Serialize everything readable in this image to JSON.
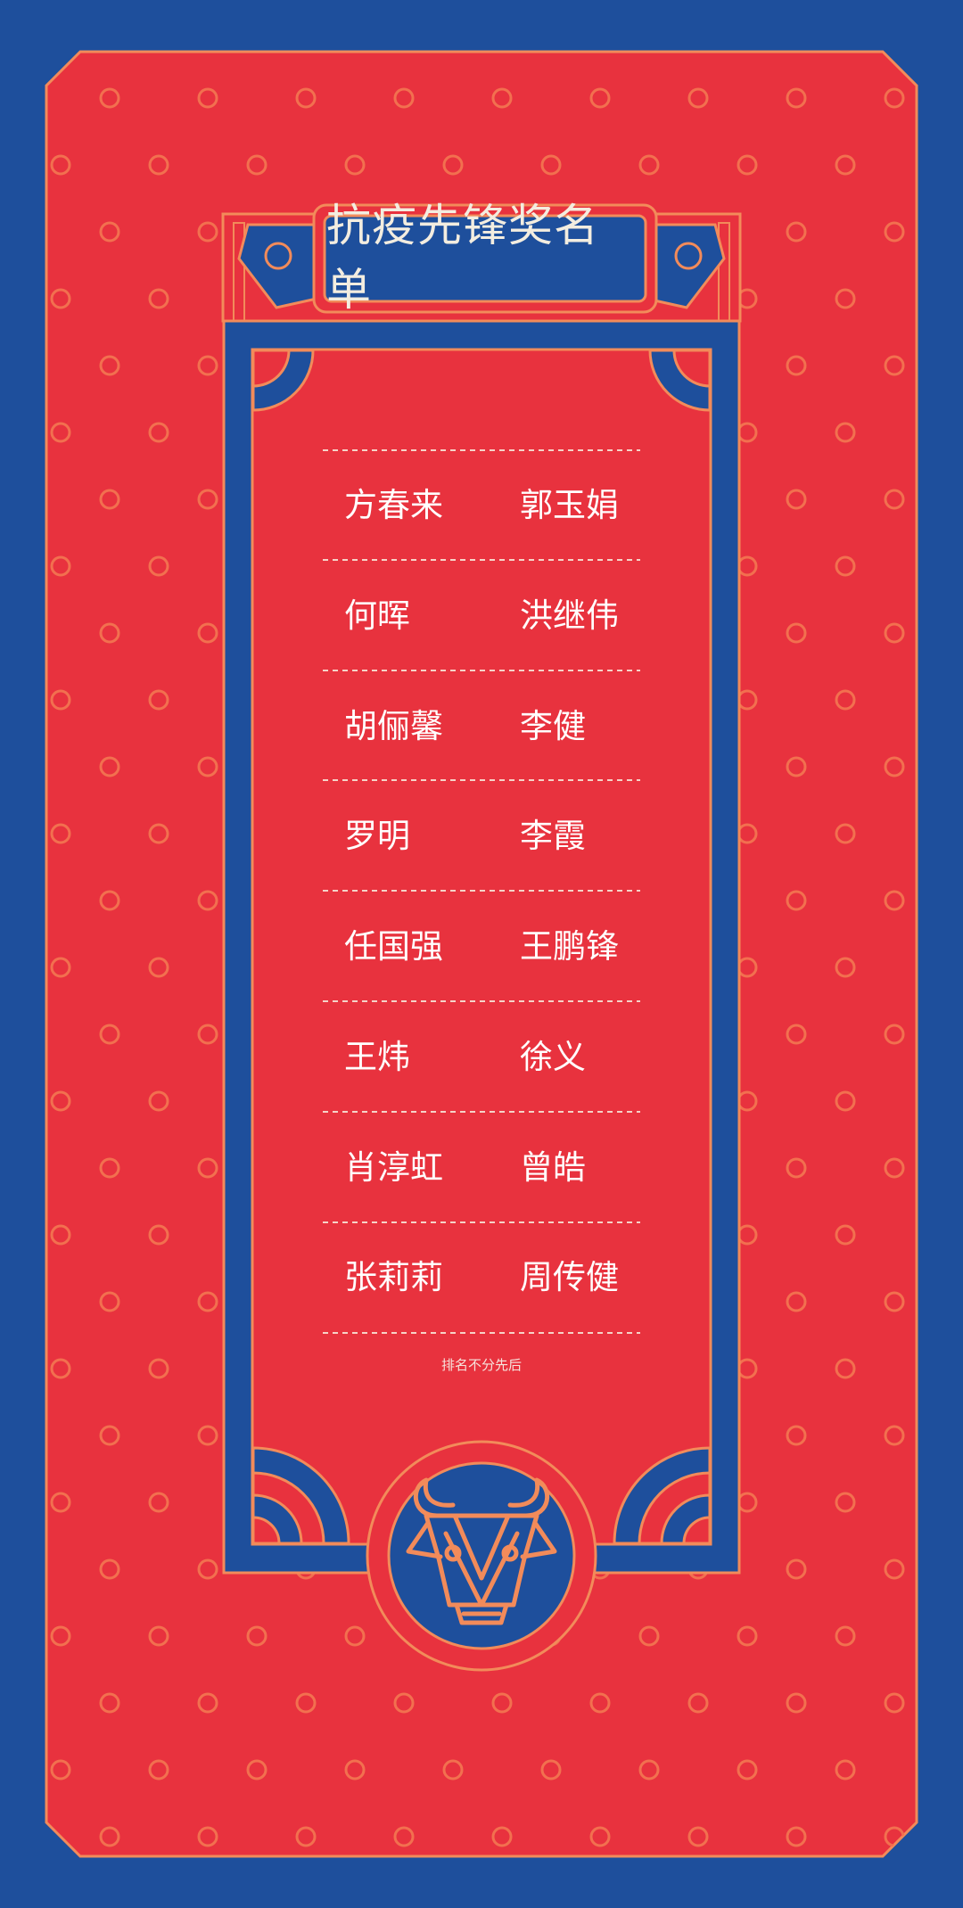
{
  "poster": {
    "title": "抗疫先锋奖名单",
    "note": "排名不分先后",
    "colors": {
      "outer_blue": "#1e4f9c",
      "panel_red": "#e8323e",
      "accent_orange": "#f28b5a",
      "text_white": "#ffffff",
      "title_text": "#f3ede0"
    },
    "icons": [
      "ring-pattern",
      "ox-head-icon",
      "corner-arch-ornament",
      "circle-ornament"
    ],
    "rows": [
      {
        "left": "方春来",
        "right": "郭玉娟"
      },
      {
        "left": "何晖",
        "right": "洪继伟"
      },
      {
        "left": "胡俪馨",
        "right": "李健"
      },
      {
        "left": "罗明",
        "right": "李霞"
      },
      {
        "left": "任国强",
        "right": "王鹏锋"
      },
      {
        "left": "王炜",
        "right": "徐义"
      },
      {
        "left": "肖淳虹",
        "right": "曾皓"
      },
      {
        "left": "张莉莉",
        "right": "周传健"
      }
    ]
  }
}
